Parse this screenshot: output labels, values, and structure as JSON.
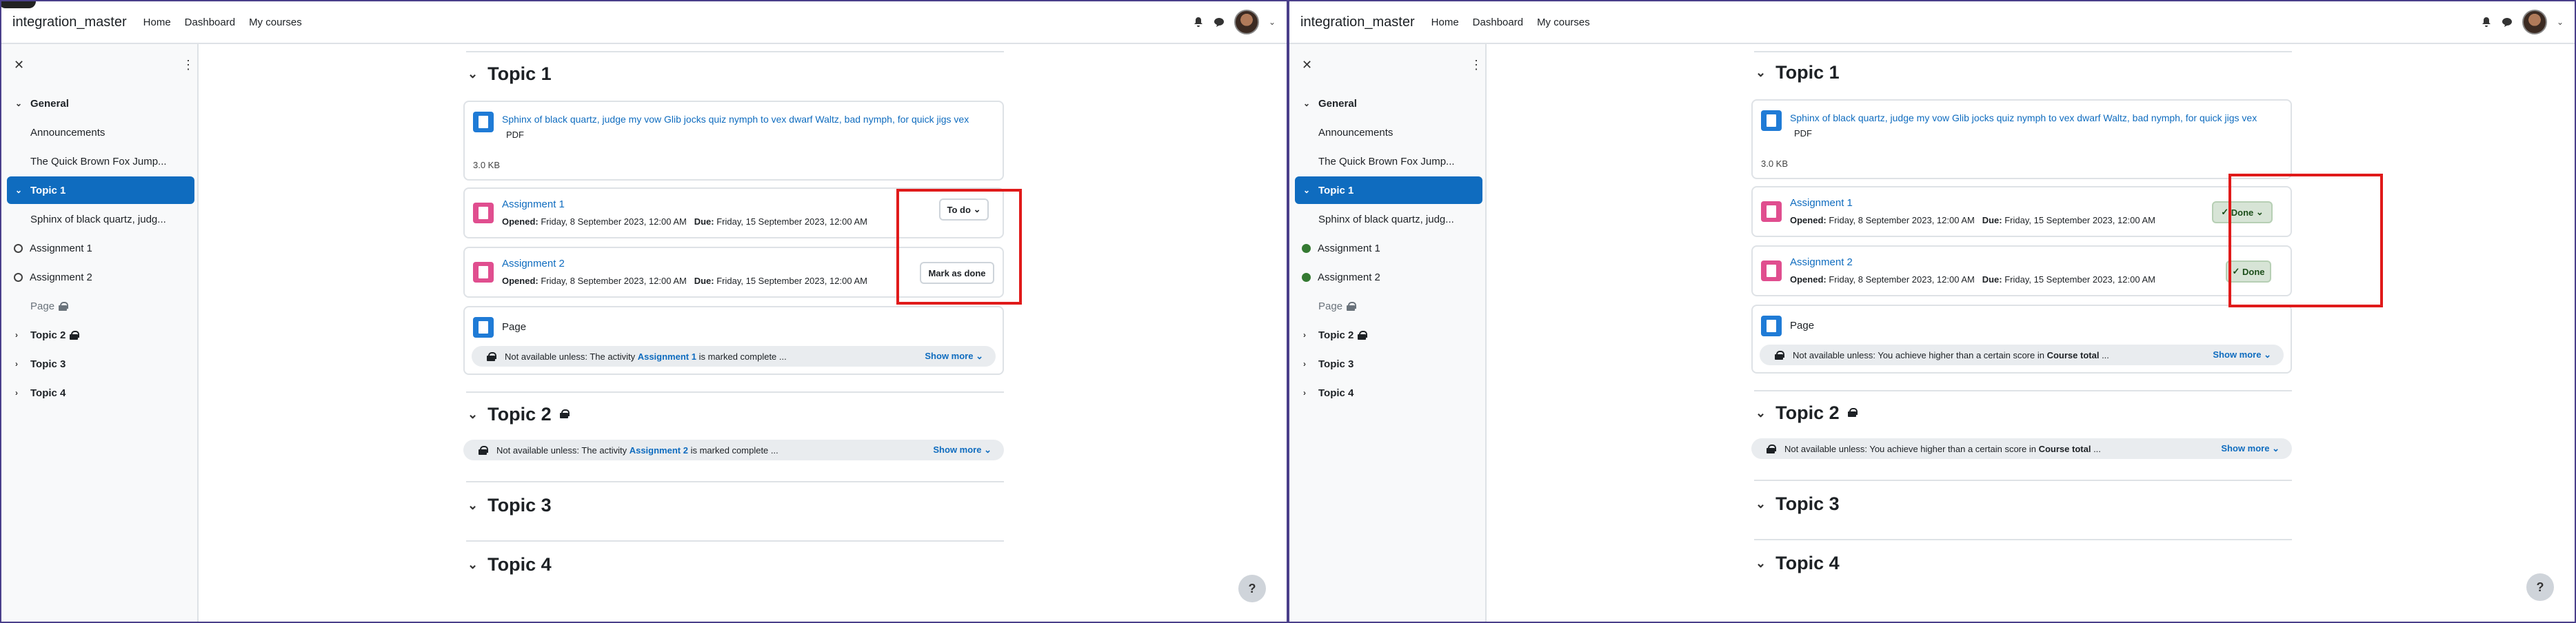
{
  "navbar": {
    "brand": "integration_master",
    "links": [
      "Home",
      "Dashboard",
      "My courses"
    ]
  },
  "drawer": {
    "items": [
      {
        "label": "General",
        "type": "section"
      },
      {
        "label": "Announcements",
        "type": "sub"
      },
      {
        "label": "The Quick Brown Fox Jump...",
        "type": "sub"
      },
      {
        "label": "Topic 1",
        "type": "section-active"
      },
      {
        "label": "Sphinx of black quartz, judg...",
        "type": "sub"
      },
      {
        "label": "Assignment 1",
        "type": "activity"
      },
      {
        "label": "Assignment 2",
        "type": "activity"
      },
      {
        "label": "Page",
        "type": "muted"
      },
      {
        "label": "Topic 2",
        "type": "section-locked"
      },
      {
        "label": "Topic 3",
        "type": "section"
      },
      {
        "label": "Topic 4",
        "type": "section"
      }
    ]
  },
  "course": {
    "topic1": "Topic 1",
    "topic2": "Topic 2",
    "topic3": "Topic 3",
    "topic4": "Topic 4",
    "file_title": "Sphinx of black quartz, judge my vow Glib jocks quiz nymph to vex dwarf Waltz, bad nymph, for quick jigs vex",
    "file_type": "PDF",
    "file_size": "3.0 KB",
    "assignment1": "Assignment 1",
    "assignment2": "Assignment 2",
    "opened_label": "Opened:",
    "opened_value": "Friday, 8 September 2023, 12:00 AM",
    "due_label": "Due:",
    "due_value": "Friday, 15 September 2023, 12:00 AM",
    "page_label": "Page",
    "show_more": "Show more"
  },
  "left": {
    "btn_todo": "To do",
    "btn_mark": "Mark as done",
    "restrict_page_pre": "Not available unless: The activity",
    "restrict_page_link": "Assignment 1",
    "restrict_page_post": "is marked complete ...",
    "restrict_topic2_pre": "Not available unless: The activity",
    "restrict_topic2_link": "Assignment 2",
    "restrict_topic2_post": "is marked complete ..."
  },
  "right": {
    "btn_done_dropdown": "Done",
    "btn_done": "Done",
    "restrict_pre": "Not available unless: You achieve higher than a certain score in",
    "restrict_bold": "Course total",
    "restrict_post": "..."
  },
  "help": "?",
  "colors": {
    "accent": "#0f6cbf",
    "highlight": "#e01a1a",
    "done": "#357a32"
  }
}
